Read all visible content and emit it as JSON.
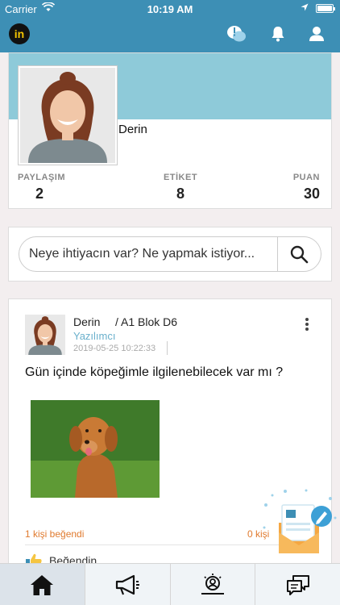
{
  "status_bar": {
    "carrier": "Carrier",
    "time": "10:19 AM"
  },
  "header": {
    "logo": "in",
    "icons": [
      "alert-chat-icon",
      "bell-icon",
      "user-icon"
    ]
  },
  "profile": {
    "name": "Derin",
    "stats": [
      {
        "label": "PAYLAŞIM",
        "value": "2"
      },
      {
        "label": "ETİKET",
        "value": "8"
      },
      {
        "label": "PUAN",
        "value": "30"
      }
    ]
  },
  "search": {
    "placeholder": "Neye ihtiyacın var? Ne yapmak istiyor..."
  },
  "post": {
    "author": "Derin",
    "location": "/ A1 Blok D6",
    "role": "Yazılımcı",
    "date": "2019-05-25 10:22:33",
    "text": "Gün içinde köpeğimle ilgilenebilecek var mı ?",
    "likes": "1 kişi beğendi",
    "comments": "0 kişi",
    "like_action": "Beğendin"
  },
  "bottom_nav": {
    "tabs": [
      "home-icon",
      "megaphone-icon",
      "search-people-icon",
      "chat-icon"
    ],
    "active_index": 0
  },
  "colors": {
    "header": "#3d8fb5",
    "banner": "#8ecad9",
    "accent_orange": "#e07a2e",
    "role_blue": "#6ab0cc"
  }
}
